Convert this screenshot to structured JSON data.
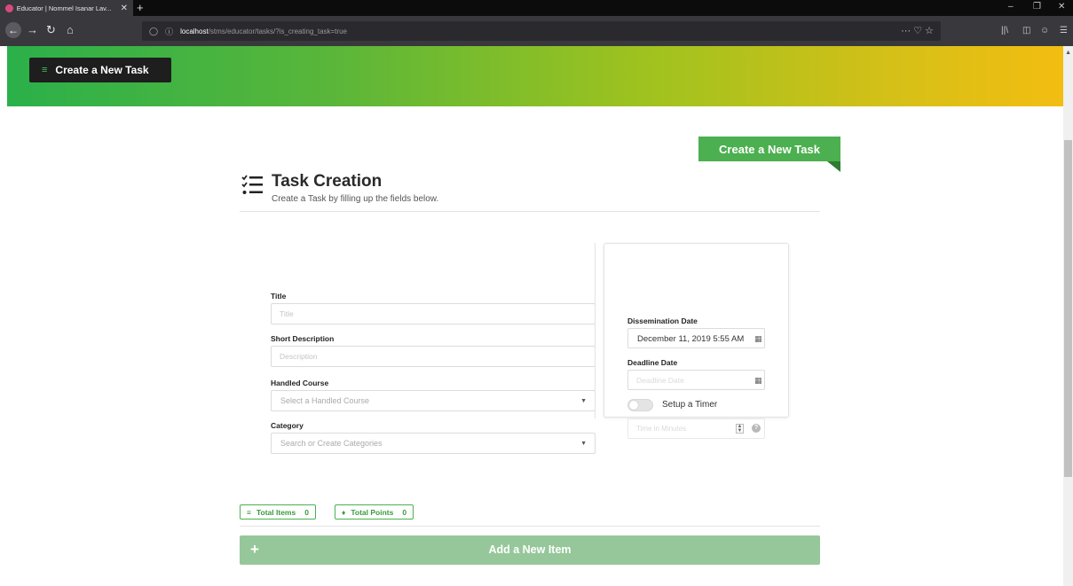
{
  "browser": {
    "tab_title": "Educator | Nommel Isanar Lav...",
    "tab_close": "✕",
    "new_tab": "+",
    "url_host": "localhost",
    "url_path": "/stms/educator/tasks/?is_creating_task=true",
    "url_actions": "···  ♡  ☆",
    "window_controls": [
      "–",
      "❐",
      "✕"
    ]
  },
  "header": {
    "banner_button_label": "Create a New Task",
    "banner_button_icon": "list-check-icon"
  },
  "ribbon": {
    "label": "Create a New Task"
  },
  "section": {
    "title": "Task Creation",
    "subtitle": "Create a Task by filling up the fields below."
  },
  "form": {
    "title_label": "Title",
    "title_placeholder": "Title",
    "short_description_label": "Short Description",
    "short_description_placeholder": "Description",
    "handled_course_label": "Handled Course",
    "handled_course_placeholder": "Select a Handled Course",
    "category_label": "Category",
    "category_placeholder": "Search or Create Categories"
  },
  "schedule": {
    "dissemination_label": "Dissemination Date",
    "dissemination_value": "December 11, 2019 5:55 AM",
    "deadline_label": "Deadline Date",
    "deadline_placeholder": "Deadline Date",
    "timer_label": "Setup a Timer",
    "timer_enabled": false,
    "timer_placeholder": "Time in Minutes"
  },
  "stats": {
    "total_items_label": "Total Items",
    "total_items_value": "0",
    "total_points_label": "Total Points",
    "total_points_value": "0"
  },
  "add_item": {
    "label": "Add a New Item",
    "plus": "+"
  },
  "colors": {
    "accent_green": "#4caf50",
    "banner_start": "#2bb04a",
    "banner_end": "#f3bd11",
    "add_item_bg": "#96c79a"
  }
}
